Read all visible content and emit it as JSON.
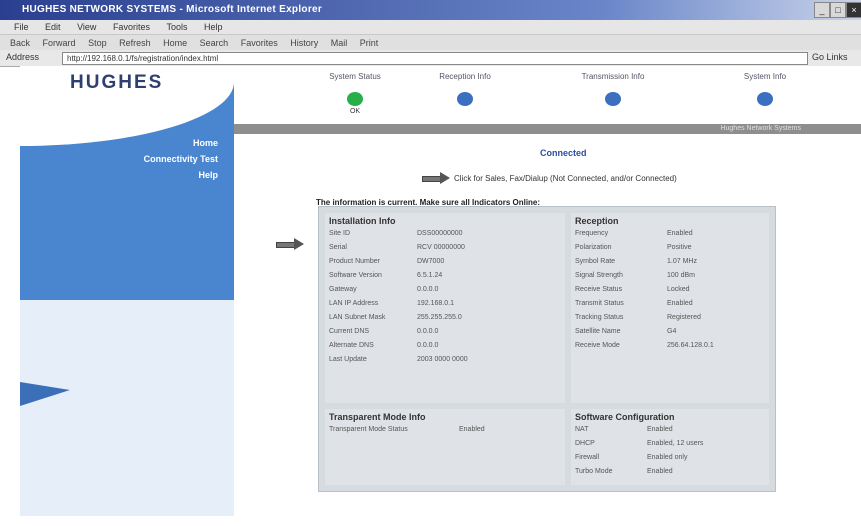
{
  "window": {
    "title": "HUGHES NETWORK SYSTEMS - Microsoft Internet Explorer"
  },
  "menubar": [
    "File",
    "Edit",
    "View",
    "Favorites",
    "Tools",
    "Help"
  ],
  "toolbar": [
    "Back",
    "Forward",
    "Stop",
    "Refresh",
    "Home",
    "Search",
    "Favorites",
    "History",
    "Mail",
    "Print"
  ],
  "address": {
    "label": "Address",
    "url": "http://192.168.0.1/fs/registration/index.html",
    "go": "Go",
    "links": "Links"
  },
  "brand": {
    "logo": "HUGHES",
    "accent": "#4a86cf"
  },
  "sidebar": {
    "links": [
      "Home",
      "Connectivity Test",
      "Help"
    ]
  },
  "topnav": {
    "items": [
      {
        "label": "System Status",
        "sub": "OK",
        "color": "#27b04a"
      },
      {
        "label": "Reception Info",
        "sub": "",
        "color": "#3d6fc0"
      },
      {
        "label": "Transmission Info",
        "sub": "",
        "color": "#3d6fc0"
      },
      {
        "label": "System Info",
        "sub": "",
        "color": "#3d6fc0"
      }
    ]
  },
  "graybar_text": "Hughes Network Systems",
  "status_title": "Connected",
  "status_note": "Click for Sales, Fax/Dialup (Not Connected, and/or Connected)",
  "intro": "The information is current. Make sure all Indicators Online:",
  "sections": {
    "installation": {
      "title": "Installation Info",
      "rows": [
        {
          "k": "Site ID",
          "v": "DSS00000000"
        },
        {
          "k": "Serial",
          "v": "RCV 00000000"
        },
        {
          "k": "Product Number",
          "v": "DW7000"
        },
        {
          "k": "Software Version",
          "v": "6.5.1.24"
        },
        {
          "k": "Gateway",
          "v": "0.0.0.0"
        },
        {
          "k": "LAN IP Address",
          "v": "192.168.0.1"
        },
        {
          "k": "LAN Subnet Mask",
          "v": "255.255.255.0"
        },
        {
          "k": "Current DNS",
          "v": "0.0.0.0"
        },
        {
          "k": "Alternate DNS",
          "v": "0.0.0.0"
        },
        {
          "k": "Last Update",
          "v": "2003 0000 0000"
        }
      ]
    },
    "reception": {
      "title": "Reception",
      "rows": [
        {
          "k": "Frequency",
          "v": "Enabled"
        },
        {
          "k": "Polarization",
          "v": "Positive"
        },
        {
          "k": "Symbol Rate",
          "v": "1.07 MHz"
        },
        {
          "k": "Signal Strength",
          "v": "100 dBm"
        },
        {
          "k": "Receive Status",
          "v": "Locked"
        },
        {
          "k": "Transmit Status",
          "v": "Enabled"
        },
        {
          "k": "Tracking Status",
          "v": "Registered"
        },
        {
          "k": "Satellite Name",
          "v": "G4"
        },
        {
          "k": "Receive Mode",
          "v": "256.64.128.0.1"
        }
      ]
    },
    "transparent": {
      "title": "Transparent Mode Info",
      "rows": [
        {
          "k": "Transparent Mode Status",
          "v": "Enabled"
        }
      ]
    },
    "software": {
      "title": "Software Configuration",
      "rows": [
        {
          "k": "NAT",
          "v": "Enabled"
        },
        {
          "k": "DHCP",
          "v": "Enabled, 12 users"
        },
        {
          "k": "Firewall",
          "v": "Enabled only"
        },
        {
          "k": "Turbo Mode",
          "v": "Enabled"
        }
      ]
    }
  }
}
